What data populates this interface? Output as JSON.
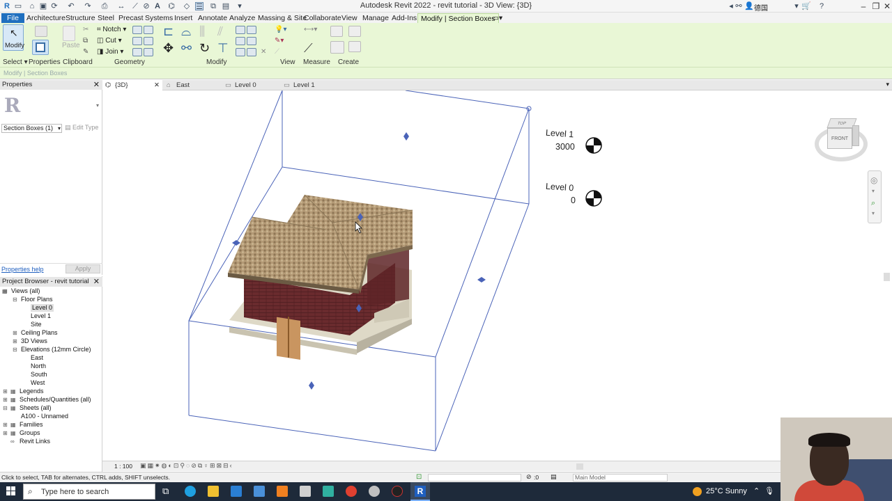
{
  "window": {
    "title": "Autodesk Revit 2022 - revit tutorial - 3D View: {3D}",
    "user": "德国"
  },
  "ribbon_tabs": [
    "File",
    "Architecture",
    "Structure",
    "Steel",
    "Precast",
    "Systems",
    "Insert",
    "Annotate",
    "Analyze",
    "Massing & Site",
    "Collaborate",
    "View",
    "Manage",
    "Add-Ins",
    "Modify | Section Boxes"
  ],
  "ribbon": {
    "modify_label": "Modify",
    "paste_label": "Paste",
    "notch_label": "Notch",
    "cut_label": "Cut",
    "join_label": "Join",
    "groups": [
      "Select",
      "Properties",
      "Clipboard",
      "Geometry",
      "Modify",
      "View",
      "Measure",
      "Create"
    ]
  },
  "context_label": "Modify | Section Boxes",
  "view_tabs": [
    "{3D}",
    "East",
    "Level 0",
    "Level 1"
  ],
  "properties": {
    "title": "Properties",
    "type_selector": "Section Boxes (1)",
    "edit_type": "Edit Type",
    "help_link": "Properties help",
    "apply": "Apply"
  },
  "project_browser": {
    "title": "Project Browser - revit tutorial",
    "items": [
      {
        "label": "Views (all)"
      },
      {
        "label": "Floor Plans"
      },
      {
        "label": "Level 0"
      },
      {
        "label": "Level 1"
      },
      {
        "label": "Site"
      },
      {
        "label": "Ceiling Plans"
      },
      {
        "label": "3D Views"
      },
      {
        "label": "Elevations (12mm Circle)"
      },
      {
        "label": "East"
      },
      {
        "label": "North"
      },
      {
        "label": "South"
      },
      {
        "label": "West"
      },
      {
        "label": "Legends"
      },
      {
        "label": "Schedules/Quantities (all)"
      },
      {
        "label": "Sheets (all)"
      },
      {
        "label": "A100 - Unnamed"
      },
      {
        "label": "Families"
      },
      {
        "label": "Groups"
      },
      {
        "label": "Revit Links"
      }
    ]
  },
  "levels": [
    {
      "name": "Level 1",
      "elevation": "3000"
    },
    {
      "name": "Level 0",
      "elevation": "0"
    }
  ],
  "viewcube": {
    "top": "TOP",
    "front": "FRONT"
  },
  "view_control": {
    "scale": "1 : 100"
  },
  "status": {
    "hint": "Click to select, TAB for alternates, CTRL adds, SHIFT unselects.",
    "workset_count": ":0",
    "model": "Main Model"
  },
  "taskbar": {
    "search_placeholder": "Type here to search",
    "weather": "25°C  Sunny"
  }
}
